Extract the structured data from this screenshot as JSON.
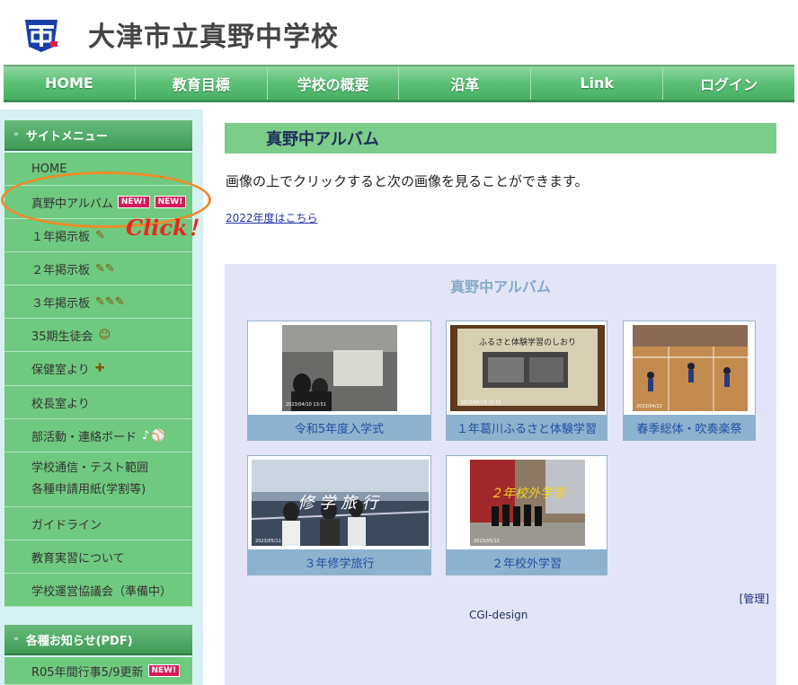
{
  "header": {
    "site_title": "大津市立真野中学校"
  },
  "nav": [
    "HOME",
    "教育目標",
    "学校の概要",
    "沿革",
    "Link",
    "ログイン"
  ],
  "sidebar": {
    "menu_head": "サイトメニュー",
    "items": [
      {
        "label": "HOME"
      },
      {
        "label": "真野中アルバム",
        "badges": [
          "NEW!",
          "NEW!"
        ]
      },
      {
        "label": "１年掲示板"
      },
      {
        "label": "２年掲示板"
      },
      {
        "label": "３年掲示板"
      },
      {
        "label": "35期生徒会"
      },
      {
        "label": "保健室より"
      },
      {
        "label": "校長室より"
      },
      {
        "label": "部活動・連絡ボード"
      },
      {
        "label": "学校通信・テスト範囲",
        "label2": "各種申請用紙(学割等)"
      },
      {
        "label": "ガイドライン"
      },
      {
        "label": "教育実習について"
      },
      {
        "label": "学校運営協議会（準備中）"
      }
    ],
    "notice_head": "各種お知らせ(PDF)",
    "notice_items": [
      {
        "label": "R05年間行事5/9更新",
        "badges": [
          "NEW!"
        ]
      }
    ]
  },
  "annotation": {
    "click_text": "Click！",
    "color": "#ee8a2a"
  },
  "main": {
    "title": "真野中アルバム",
    "intro": "画像の上でクリックすると次の画像を見ることができます。",
    "link_2022": "2022年度はこちら"
  },
  "album": {
    "title": "真野中アルバム",
    "cards": [
      {
        "caption": "令和5年度入学式",
        "stamp": "2023/04/10 13:51"
      },
      {
        "caption": "１年葛川ふるさと体験学習",
        "stamp": "2023/04/19 16:55",
        "photo_text": "ふるさと体験学習のしおり"
      },
      {
        "caption": "春季総体・吹奏楽祭",
        "stamp": "2023/04/22"
      },
      {
        "caption": "３年修学旅行",
        "stamp": "2023/05/11",
        "photo_text": "修 学 旅 行"
      },
      {
        "caption": "２年校外学習",
        "stamp": "2023/05/12",
        "photo_text": "２年校外学習"
      }
    ],
    "admin": "[管理]",
    "credit": "CGI-design"
  }
}
